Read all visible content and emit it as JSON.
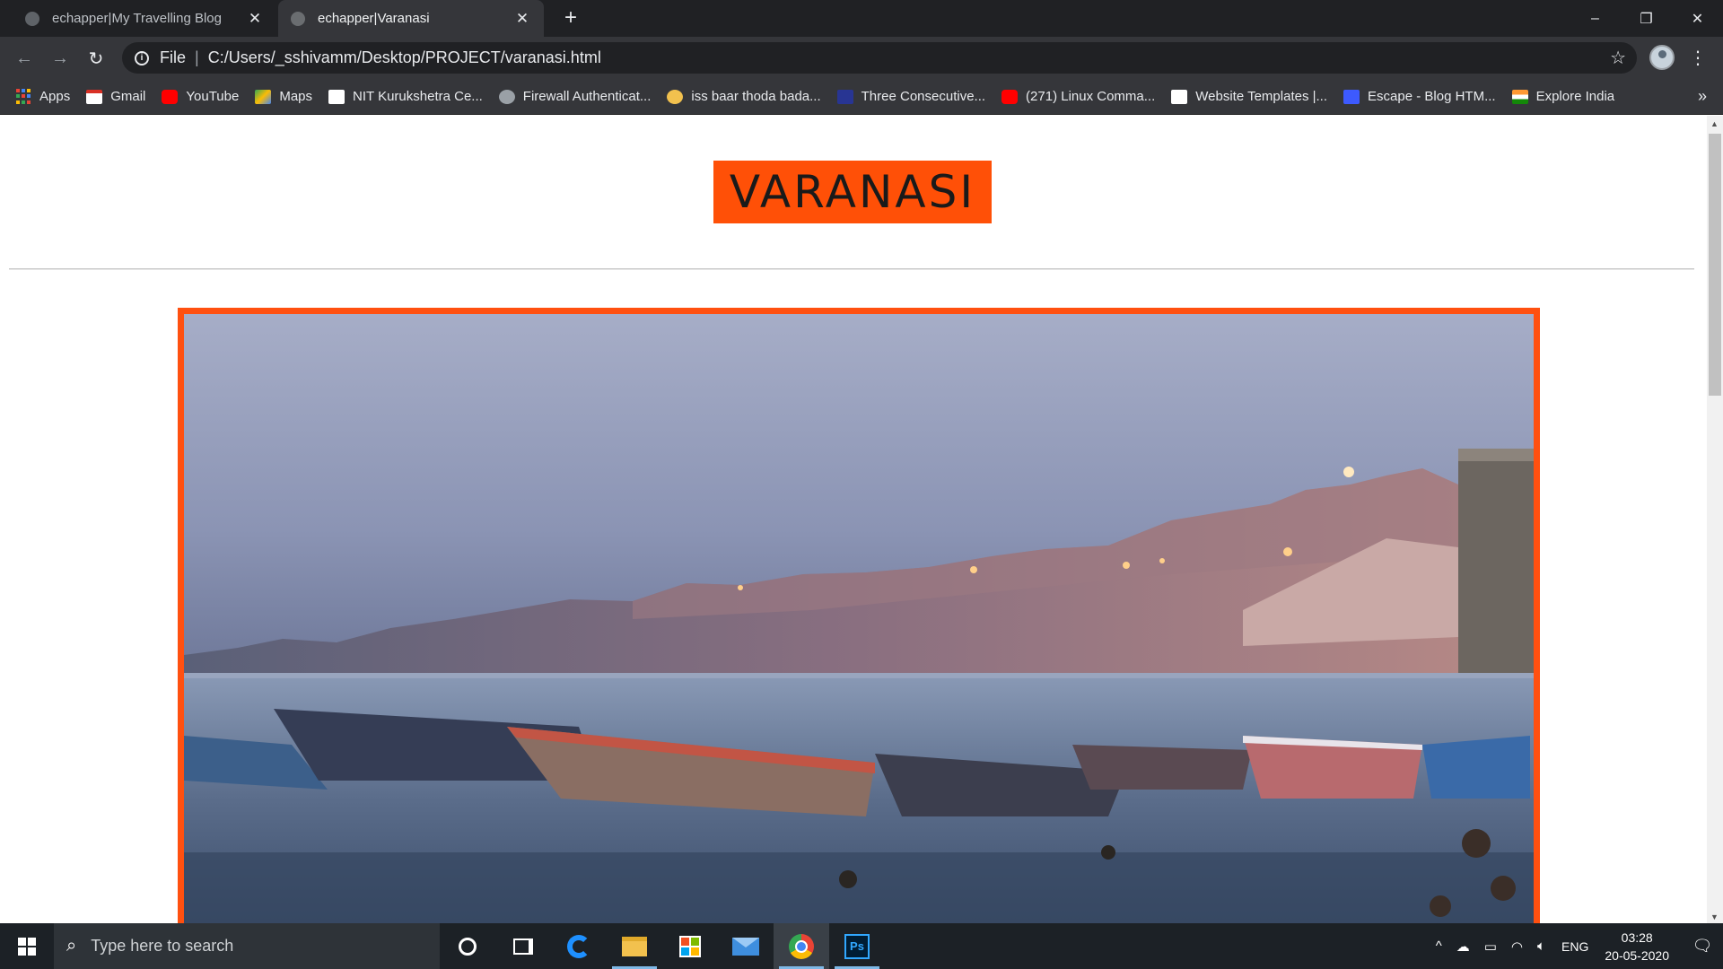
{
  "browser": {
    "tabs": [
      {
        "title": "echapper|My Travelling Blog",
        "active": false
      },
      {
        "title": "echapper|Varanasi",
        "active": true
      }
    ],
    "new_tab_symbol": "+",
    "window_controls": {
      "minimize": "–",
      "maximize": "❐",
      "close": "✕"
    },
    "nav": {
      "back": "←",
      "forward": "→",
      "reload": "↻"
    },
    "address": {
      "scheme_chip": "File",
      "url": "C:/Users/_sshivamm/Desktop/PROJECT/varanasi.html"
    },
    "bookmarks": [
      {
        "label": "Apps",
        "icon": "apps-grid-icon"
      },
      {
        "label": "Gmail",
        "icon": "gmail-icon",
        "color": "#d93025"
      },
      {
        "label": "YouTube",
        "icon": "youtube-icon",
        "color": "#ff0000"
      },
      {
        "label": "Maps",
        "icon": "maps-icon",
        "color": "#34a853"
      },
      {
        "label": "NIT Kurukshetra Ce...",
        "icon": "nit-icon",
        "color": "#ffffff"
      },
      {
        "label": "Firewall Authenticat...",
        "icon": "globe-icon",
        "color": "#9aa0a6"
      },
      {
        "label": "iss baar thoda bada...",
        "icon": "smiley-icon",
        "color": "#f2c14e"
      },
      {
        "label": "Three Consecutive...",
        "icon": "bookmark-doc-icon",
        "color": "#283593"
      },
      {
        "label": "(271) Linux Comma...",
        "icon": "youtube-icon",
        "color": "#ff0000"
      },
      {
        "label": "Website Templates |...",
        "icon": "wix-icon",
        "color": "#ffffff"
      },
      {
        "label": "Escape - Blog HTM...",
        "icon": "w-icon",
        "color": "#3d5afe"
      },
      {
        "label": "Explore India",
        "icon": "india-flag-icon",
        "color": "#ff9933"
      }
    ],
    "bookmarks_overflow": "»"
  },
  "page": {
    "heading": "VARANASI",
    "accent_color": "#ff5007",
    "image_alt": "Boats on the Ganges at the Varanasi ghats at dusk"
  },
  "taskbar": {
    "search_placeholder": "Type here to search",
    "apps": [
      "cortana",
      "task-view",
      "edge",
      "file-explorer",
      "store",
      "mail",
      "chrome",
      "photoshop"
    ],
    "photoshop_label": "Ps",
    "language": "ENG",
    "time": "03:28",
    "date": "20-05-2020"
  }
}
